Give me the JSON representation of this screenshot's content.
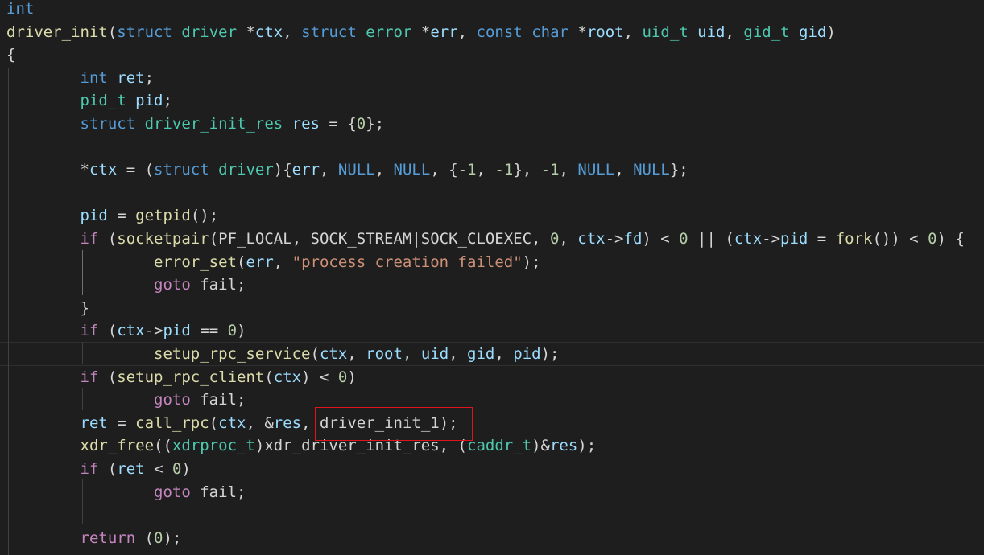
{
  "editor": {
    "language": "c",
    "theme": "dark",
    "colors": {
      "background": "#1e1e1e",
      "keyword": "#569cd6",
      "control": "#c586c0",
      "function": "#dcdcaa",
      "type": "#4ec9b0",
      "variable": "#9cdcfe",
      "number": "#b5cea8",
      "string": "#ce9178",
      "text": "#d4d4d4",
      "highlight_box": "#e0141c"
    },
    "highlighted_token": "driver_init_1",
    "lines": [
      [
        {
          "t": "int",
          "c": "kw"
        }
      ],
      [
        {
          "t": "driver_init",
          "c": "fn"
        },
        {
          "t": "(",
          "c": "plain"
        },
        {
          "t": "struct",
          "c": "kw"
        },
        {
          "t": " ",
          "c": "plain"
        },
        {
          "t": "driver",
          "c": "ty"
        },
        {
          "t": " *",
          "c": "plain"
        },
        {
          "t": "ctx",
          "c": "var"
        },
        {
          "t": ", ",
          "c": "plain"
        },
        {
          "t": "struct",
          "c": "kw"
        },
        {
          "t": " ",
          "c": "plain"
        },
        {
          "t": "error",
          "c": "ty"
        },
        {
          "t": " *",
          "c": "plain"
        },
        {
          "t": "err",
          "c": "var"
        },
        {
          "t": ", ",
          "c": "plain"
        },
        {
          "t": "const",
          "c": "kw"
        },
        {
          "t": " ",
          "c": "plain"
        },
        {
          "t": "char",
          "c": "kw"
        },
        {
          "t": " *",
          "c": "plain"
        },
        {
          "t": "root",
          "c": "var"
        },
        {
          "t": ", ",
          "c": "plain"
        },
        {
          "t": "uid_t",
          "c": "ty"
        },
        {
          "t": " ",
          "c": "plain"
        },
        {
          "t": "uid",
          "c": "var"
        },
        {
          "t": ", ",
          "c": "plain"
        },
        {
          "t": "gid_t",
          "c": "ty"
        },
        {
          "t": " ",
          "c": "plain"
        },
        {
          "t": "gid",
          "c": "var"
        },
        {
          "t": ")",
          "c": "plain"
        }
      ],
      [
        {
          "t": "{",
          "c": "plain"
        }
      ],
      [
        {
          "t": "        ",
          "c": "plain"
        },
        {
          "t": "int",
          "c": "kw"
        },
        {
          "t": " ",
          "c": "plain"
        },
        {
          "t": "ret",
          "c": "var"
        },
        {
          "t": ";",
          "c": "plain"
        }
      ],
      [
        {
          "t": "        ",
          "c": "plain"
        },
        {
          "t": "pid_t",
          "c": "ty"
        },
        {
          "t": " ",
          "c": "plain"
        },
        {
          "t": "pid",
          "c": "var"
        },
        {
          "t": ";",
          "c": "plain"
        }
      ],
      [
        {
          "t": "        ",
          "c": "plain"
        },
        {
          "t": "struct",
          "c": "kw"
        },
        {
          "t": " ",
          "c": "plain"
        },
        {
          "t": "driver_init_res",
          "c": "ty"
        },
        {
          "t": " ",
          "c": "plain"
        },
        {
          "t": "res",
          "c": "var"
        },
        {
          "t": " = {",
          "c": "plain"
        },
        {
          "t": "0",
          "c": "num"
        },
        {
          "t": "};",
          "c": "plain"
        }
      ],
      [],
      [
        {
          "t": "        *",
          "c": "plain"
        },
        {
          "t": "ctx",
          "c": "var"
        },
        {
          "t": " = (",
          "c": "plain"
        },
        {
          "t": "struct",
          "c": "kw"
        },
        {
          "t": " ",
          "c": "plain"
        },
        {
          "t": "driver",
          "c": "ty"
        },
        {
          "t": "){",
          "c": "plain"
        },
        {
          "t": "err",
          "c": "var"
        },
        {
          "t": ", ",
          "c": "plain"
        },
        {
          "t": "NULL",
          "c": "mac"
        },
        {
          "t": ", ",
          "c": "plain"
        },
        {
          "t": "NULL",
          "c": "mac"
        },
        {
          "t": ", {",
          "c": "plain"
        },
        {
          "t": "-1",
          "c": "num"
        },
        {
          "t": ", ",
          "c": "plain"
        },
        {
          "t": "-1",
          "c": "num"
        },
        {
          "t": "}, ",
          "c": "plain"
        },
        {
          "t": "-1",
          "c": "num"
        },
        {
          "t": ", ",
          "c": "plain"
        },
        {
          "t": "NULL",
          "c": "mac"
        },
        {
          "t": ", ",
          "c": "plain"
        },
        {
          "t": "NULL",
          "c": "mac"
        },
        {
          "t": "};",
          "c": "plain"
        }
      ],
      [],
      [
        {
          "t": "        ",
          "c": "plain"
        },
        {
          "t": "pid",
          "c": "var"
        },
        {
          "t": " = ",
          "c": "plain"
        },
        {
          "t": "getpid",
          "c": "fn"
        },
        {
          "t": "();",
          "c": "plain"
        }
      ],
      [
        {
          "t": "        ",
          "c": "plain"
        },
        {
          "t": "if",
          "c": "ctrl"
        },
        {
          "t": " (",
          "c": "plain"
        },
        {
          "t": "socketpair",
          "c": "fn"
        },
        {
          "t": "(PF_LOCAL, SOCK_STREAM|SOCK_CLOEXEC, ",
          "c": "plain"
        },
        {
          "t": "0",
          "c": "num"
        },
        {
          "t": ", ",
          "c": "plain"
        },
        {
          "t": "ctx",
          "c": "var"
        },
        {
          "t": "->",
          "c": "plain"
        },
        {
          "t": "fd",
          "c": "var"
        },
        {
          "t": ") < ",
          "c": "plain"
        },
        {
          "t": "0",
          "c": "num"
        },
        {
          "t": " || (",
          "c": "plain"
        },
        {
          "t": "ctx",
          "c": "var"
        },
        {
          "t": "->",
          "c": "plain"
        },
        {
          "t": "pid",
          "c": "var"
        },
        {
          "t": " = ",
          "c": "plain"
        },
        {
          "t": "fork",
          "c": "fn"
        },
        {
          "t": "()) < ",
          "c": "plain"
        },
        {
          "t": "0",
          "c": "num"
        },
        {
          "t": ") {",
          "c": "plain"
        }
      ],
      [
        {
          "t": "                ",
          "c": "plain"
        },
        {
          "t": "error_set",
          "c": "fn"
        },
        {
          "t": "(",
          "c": "plain"
        },
        {
          "t": "err",
          "c": "var"
        },
        {
          "t": ", ",
          "c": "plain"
        },
        {
          "t": "\"process creation failed\"",
          "c": "str"
        },
        {
          "t": ");",
          "c": "plain"
        }
      ],
      [
        {
          "t": "                ",
          "c": "plain"
        },
        {
          "t": "goto",
          "c": "ctrl"
        },
        {
          "t": " fail;",
          "c": "plain"
        }
      ],
      [
        {
          "t": "        }",
          "c": "plain"
        }
      ],
      [
        {
          "t": "        ",
          "c": "plain"
        },
        {
          "t": "if",
          "c": "ctrl"
        },
        {
          "t": " (",
          "c": "plain"
        },
        {
          "t": "ctx",
          "c": "var"
        },
        {
          "t": "->",
          "c": "plain"
        },
        {
          "t": "pid",
          "c": "var"
        },
        {
          "t": " == ",
          "c": "plain"
        },
        {
          "t": "0",
          "c": "num"
        },
        {
          "t": ")",
          "c": "plain"
        }
      ],
      [
        {
          "t": "                ",
          "c": "plain"
        },
        {
          "t": "setup_rpc_service",
          "c": "fn"
        },
        {
          "t": "(",
          "c": "plain"
        },
        {
          "t": "ctx",
          "c": "var"
        },
        {
          "t": ", ",
          "c": "plain"
        },
        {
          "t": "root",
          "c": "var"
        },
        {
          "t": ", ",
          "c": "plain"
        },
        {
          "t": "uid",
          "c": "var"
        },
        {
          "t": ", ",
          "c": "plain"
        },
        {
          "t": "gid",
          "c": "var"
        },
        {
          "t": ", ",
          "c": "plain"
        },
        {
          "t": "pid",
          "c": "var"
        },
        {
          "t": ");",
          "c": "plain"
        }
      ],
      [
        {
          "t": "        ",
          "c": "plain"
        },
        {
          "t": "if",
          "c": "ctrl"
        },
        {
          "t": " (",
          "c": "plain"
        },
        {
          "t": "setup_rpc_client",
          "c": "fn"
        },
        {
          "t": "(",
          "c": "plain"
        },
        {
          "t": "ctx",
          "c": "var"
        },
        {
          "t": ") < ",
          "c": "plain"
        },
        {
          "t": "0",
          "c": "num"
        },
        {
          "t": ")",
          "c": "plain"
        }
      ],
      [
        {
          "t": "                ",
          "c": "plain"
        },
        {
          "t": "goto",
          "c": "ctrl"
        },
        {
          "t": " fail;",
          "c": "plain"
        }
      ],
      [
        {
          "t": "        ",
          "c": "plain"
        },
        {
          "t": "ret",
          "c": "var"
        },
        {
          "t": " = ",
          "c": "plain"
        },
        {
          "t": "call_rpc",
          "c": "fn"
        },
        {
          "t": "(",
          "c": "plain"
        },
        {
          "t": "ctx",
          "c": "var"
        },
        {
          "t": ", &",
          "c": "plain"
        },
        {
          "t": "res",
          "c": "var"
        },
        {
          "t": ", ",
          "c": "plain"
        },
        {
          "t": "driver_init_1",
          "c": "plain"
        },
        {
          "t": ");",
          "c": "plain"
        }
      ],
      [
        {
          "t": "        ",
          "c": "plain"
        },
        {
          "t": "xdr_free",
          "c": "fn"
        },
        {
          "t": "((",
          "c": "plain"
        },
        {
          "t": "xdrproc_t",
          "c": "ty"
        },
        {
          "t": ")",
          "c": "plain"
        },
        {
          "t": "xdr_driver_init_res",
          "c": "plain"
        },
        {
          "t": ", (",
          "c": "plain"
        },
        {
          "t": "caddr_t",
          "c": "ty"
        },
        {
          "t": ")&",
          "c": "plain"
        },
        {
          "t": "res",
          "c": "var"
        },
        {
          "t": ");",
          "c": "plain"
        }
      ],
      [
        {
          "t": "        ",
          "c": "plain"
        },
        {
          "t": "if",
          "c": "ctrl"
        },
        {
          "t": " (",
          "c": "plain"
        },
        {
          "t": "ret",
          "c": "var"
        },
        {
          "t": " < ",
          "c": "plain"
        },
        {
          "t": "0",
          "c": "num"
        },
        {
          "t": ")",
          "c": "plain"
        }
      ],
      [
        {
          "t": "                ",
          "c": "plain"
        },
        {
          "t": "goto",
          "c": "ctrl"
        },
        {
          "t": " fail;",
          "c": "plain"
        }
      ],
      [],
      [
        {
          "t": "        ",
          "c": "plain"
        },
        {
          "t": "return",
          "c": "ctrl"
        },
        {
          "t": " (",
          "c": "plain"
        },
        {
          "t": "0",
          "c": "num"
        },
        {
          "t": ");",
          "c": "plain"
        }
      ]
    ]
  }
}
